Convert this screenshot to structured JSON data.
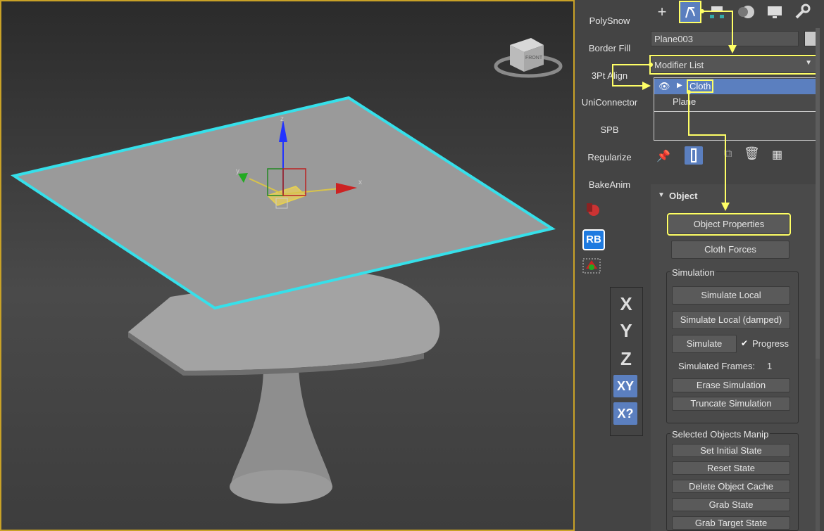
{
  "viewport": {
    "viewcube_label": "FRONT",
    "gizmo": {
      "x": "x",
      "y": "y",
      "z": "z"
    }
  },
  "toolstrip": {
    "items": [
      "PolySnow",
      "Border Fill",
      "3Pt Align",
      "UniConnector",
      "SPB",
      "Regularize",
      "BakeAnim"
    ],
    "rb_label": "RB"
  },
  "axis_panel": {
    "x": "X",
    "y": "Y",
    "z": "Z",
    "xy": "XY",
    "xyq": "X?"
  },
  "command_panel": {
    "object_name": "Plane003",
    "modifier_list": "Modifier List",
    "stack": [
      {
        "name": "Cloth",
        "selected": true
      },
      {
        "name": "Plane",
        "selected": false
      }
    ],
    "rollout_title": "Object",
    "buttons": {
      "object_properties": "Object Properties",
      "cloth_forces": "Cloth Forces"
    },
    "simulation": {
      "title": "Simulation",
      "simulate_local": "Simulate Local",
      "simulate_local_damped": "Simulate Local (damped)",
      "simulate": "Simulate",
      "progress_label": "Progress",
      "progress_checked": true,
      "frames_label": "Simulated Frames:",
      "frames_value": "1",
      "erase": "Erase Simulation",
      "truncate": "Truncate Simulation"
    },
    "manip": {
      "title": "Selected Objects Manip",
      "set_initial": "Set Initial State",
      "reset": "Reset State",
      "delete_cache": "Delete Object Cache",
      "grab": "Grab State",
      "grab_target": "Grab Target State"
    }
  },
  "colors": {
    "highlight": "#ffff66",
    "selection": "#5b7fbf",
    "wire": "#36e0ea"
  }
}
